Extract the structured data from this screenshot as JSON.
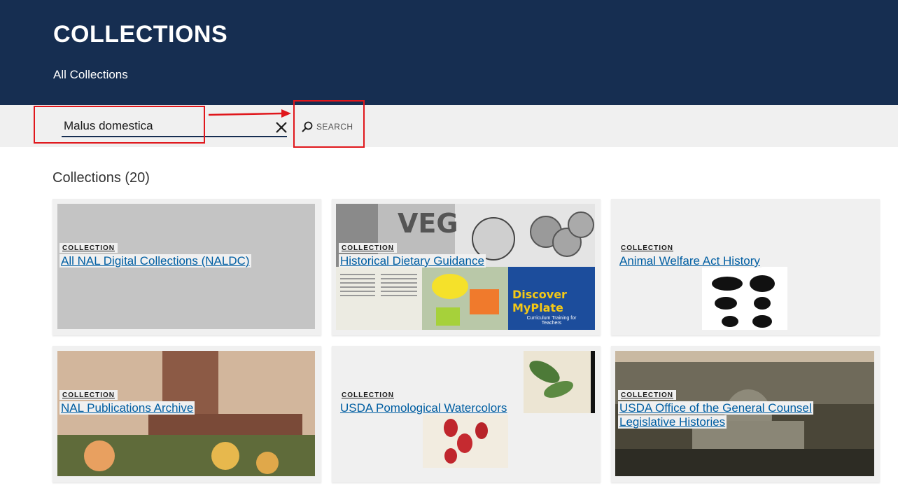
{
  "header": {
    "title": "COLLECTIONS",
    "breadcrumb": "All Collections",
    "bg_color": "#162e51"
  },
  "search": {
    "value": "Malus domestica",
    "clear_icon": "close-icon",
    "button_label": "SEARCH",
    "button_icon": "search-icon"
  },
  "results": {
    "heading": "Collections (20)"
  },
  "cards": [
    {
      "tag": "COLLECTION",
      "title": "All NAL Digital Collections (NALDC)"
    },
    {
      "tag": "COLLECTION",
      "title": "Historical Dietary Guidance"
    },
    {
      "tag": "COLLECTION",
      "title": "Animal Welfare Act History"
    },
    {
      "tag": "COLLECTION",
      "title": "NAL Publications Archive"
    },
    {
      "tag": "COLLECTION",
      "title": "USDA Pomological Watercolors"
    },
    {
      "tag": "COLLECTION",
      "title": "USDA Office of the General Counsel Legislative Histories"
    }
  ],
  "thumbnails": {
    "dietary_tiles": [
      "VEG",
      "Discover MyPlate",
      "Curriculum Training for Teachers"
    ]
  },
  "annotation_color": "#e0171c"
}
